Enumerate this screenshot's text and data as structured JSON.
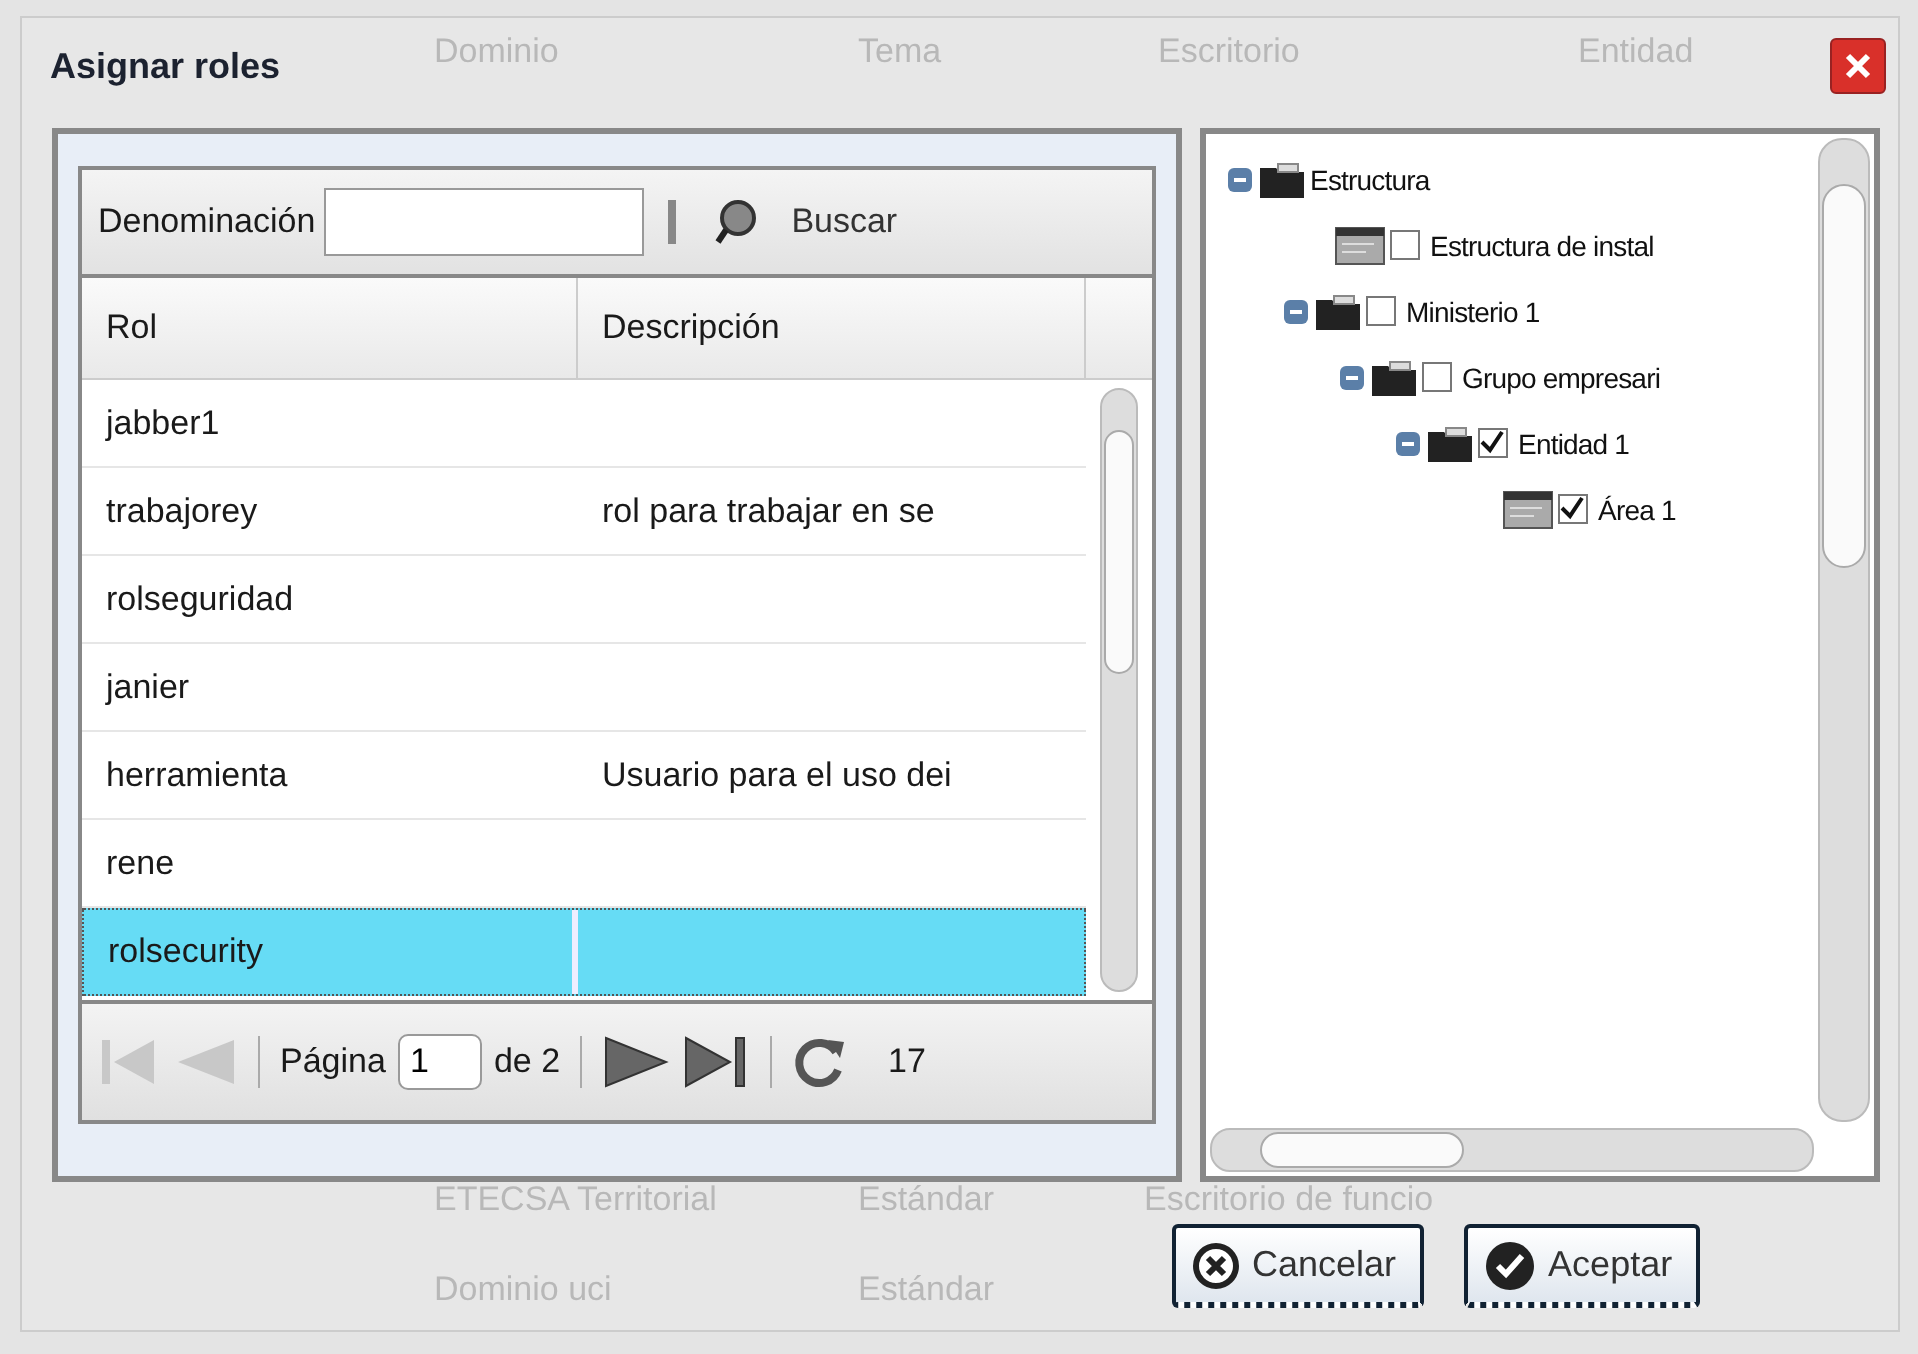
{
  "background": {
    "columns": [
      "Dominio",
      "Tema",
      "Escritorio",
      "Entidad"
    ],
    "rows": [
      [
        "ETECSA Territorial",
        "Estándar",
        "Escritorio de funcio"
      ],
      [
        "Dominio uci",
        "Estándar"
      ]
    ]
  },
  "dialog": {
    "title": "Asignar roles"
  },
  "search": {
    "label": "Denominación",
    "button": "Buscar"
  },
  "table": {
    "columns": [
      "Rol",
      "Descripción"
    ],
    "rows": [
      {
        "rol": "jabber1",
        "selected": false
      },
      {
        "rol": "trabajorey",
        "descripcion": "rol para trabajar en se",
        "selected": false
      },
      {
        "rol": "rolseguridad",
        "selected": false
      },
      {
        "rol": "janier",
        "selected": false
      },
      {
        "rol": "herramienta",
        "descripcion": "Usuario para el uso dei",
        "selected": false
      },
      {
        "rol": "rene",
        "selected": false
      },
      {
        "rol": "rolsecurity",
        "selected": true
      }
    ]
  },
  "pager": {
    "label": "Página",
    "page": "1",
    "of": "de 2",
    "total": "17",
    "first_disabled": true,
    "prev_disabled": true,
    "next_disabled": false,
    "last_disabled": false
  },
  "tree": [
    {
      "label": "Estructura",
      "kind": "folder",
      "expanded": true,
      "children": [
        {
          "label": "Estructura de instal",
          "kind": "leaf",
          "checked": false
        },
        {
          "label": "Ministerio 1",
          "kind": "folder",
          "expanded": true,
          "checked": false,
          "children": [
            {
              "label": "Grupo empresari",
              "kind": "folder",
              "expanded": true,
              "checked": false,
              "children": [
                {
                  "label": "Entidad 1",
                  "kind": "folder",
                  "expanded": true,
                  "checked": true,
                  "children": [
                    {
                      "label": "Área 1",
                      "kind": "leaf",
                      "checked": true
                    }
                  ]
                }
              ]
            }
          ]
        }
      ]
    }
  ],
  "buttons": [
    {
      "label": "Cancelar",
      "kind": "cancel"
    },
    {
      "label": "Aceptar",
      "kind": "accept"
    }
  ]
}
